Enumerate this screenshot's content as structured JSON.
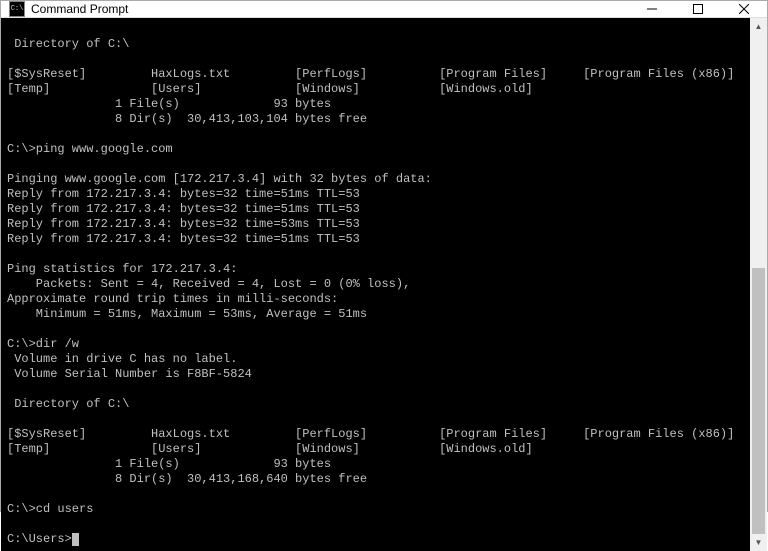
{
  "window": {
    "title": "Command Prompt",
    "icon_label": "C:\\"
  },
  "lines": [
    "",
    " Directory of C:\\",
    "",
    "[$SysReset]         HaxLogs.txt         [PerfLogs]          [Program Files]     [Program Files (x86)]",
    "[Temp]              [Users]             [Windows]           [Windows.old]",
    "               1 File(s)             93 bytes",
    "               8 Dir(s)  30,413,103,104 bytes free",
    "",
    "C:\\>ping www.google.com",
    "",
    "Pinging www.google.com [172.217.3.4] with 32 bytes of data:",
    "Reply from 172.217.3.4: bytes=32 time=51ms TTL=53",
    "Reply from 172.217.3.4: bytes=32 time=51ms TTL=53",
    "Reply from 172.217.3.4: bytes=32 time=53ms TTL=53",
    "Reply from 172.217.3.4: bytes=32 time=51ms TTL=53",
    "",
    "Ping statistics for 172.217.3.4:",
    "    Packets: Sent = 4, Received = 4, Lost = 0 (0% loss),",
    "Approximate round trip times in milli-seconds:",
    "    Minimum = 51ms, Maximum = 53ms, Average = 51ms",
    "",
    "C:\\>dir /w",
    " Volume in drive C has no label.",
    " Volume Serial Number is F8BF-5824",
    "",
    " Directory of C:\\",
    "",
    "[$SysReset]         HaxLogs.txt         [PerfLogs]          [Program Files]     [Program Files (x86)]",
    "[Temp]              [Users]             [Windows]           [Windows.old]",
    "               1 File(s)             93 bytes",
    "               8 Dir(s)  30,413,168,640 bytes free",
    "",
    "C:\\>cd users",
    "",
    "C:\\Users>"
  ]
}
